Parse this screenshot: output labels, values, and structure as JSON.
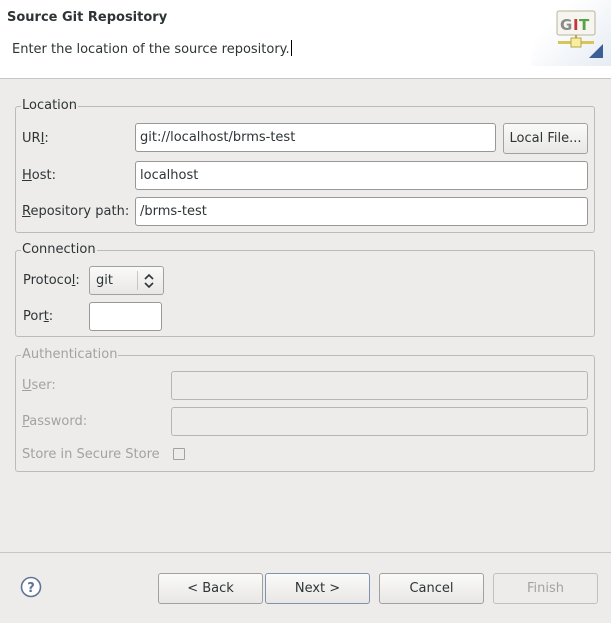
{
  "header": {
    "title": "Source Git Repository",
    "description": "Enter the location of the source repository.",
    "banner_icon": "git-icon"
  },
  "location": {
    "group_label": "Location",
    "uri_label_pre": "UR",
    "uri_label_mnemonic": "I",
    "uri_label_post": ":",
    "uri_value": "git://localhost/brms-test",
    "local_file_button": "Local File...",
    "host_label_mnemonic": "H",
    "host_label_post": "ost:",
    "host_value": "localhost",
    "repo_path_label_mnemonic": "R",
    "repo_path_label_post": "epository path:",
    "repo_path_value": "/brms-test"
  },
  "connection": {
    "group_label": "Connection",
    "protocol_label_pre": "Protoco",
    "protocol_label_mnemonic": "l",
    "protocol_label_post": ":",
    "protocol_value": "git",
    "port_label_pre": "Por",
    "port_label_mnemonic": "t",
    "port_label_post": ":",
    "port_value": ""
  },
  "authentication": {
    "group_label": "Authentication",
    "user_label_mnemonic": "U",
    "user_label_post": "ser:",
    "user_value": "",
    "password_label_mnemonic": "P",
    "password_label_post": "assword:",
    "password_value": "",
    "secure_store_label": "Store in Secure Store",
    "secure_store_checked": false
  },
  "footer": {
    "help_icon": "help-icon",
    "back_button": "< Back",
    "next_button": "Next >",
    "cancel_button": "Cancel",
    "finish_button": "Finish"
  }
}
